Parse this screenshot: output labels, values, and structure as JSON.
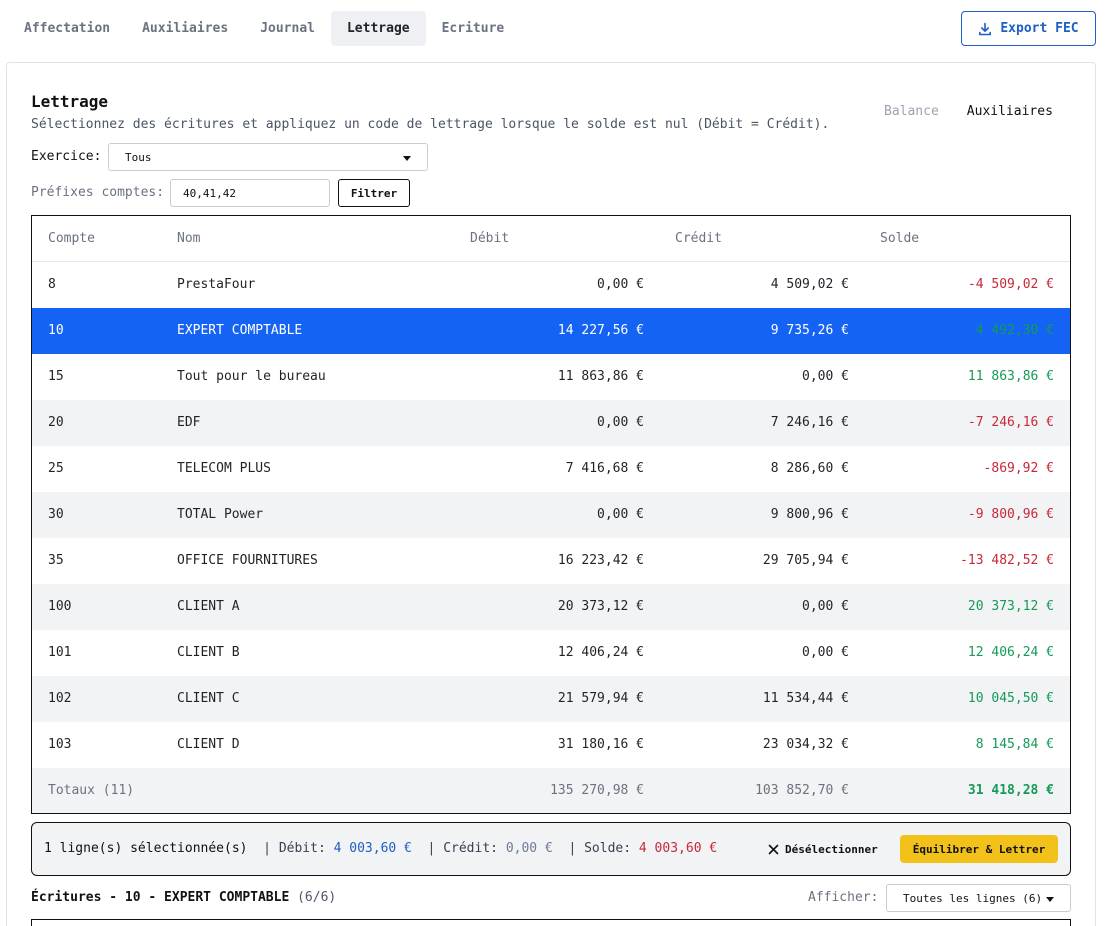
{
  "tabs": [
    "Affectation",
    "Auxiliaires",
    "Journal",
    "Lettrage",
    "Ecriture"
  ],
  "active_tab": "Lettrage",
  "export_label": "Export FEC",
  "title": "Lettrage",
  "subtitle": "Sélectionnez des écritures et appliquez un code de lettrage lorsque le solde est nul (Débit = Crédit).",
  "view_switch": [
    "Balance",
    "Auxiliaires"
  ],
  "exercice": {
    "label": "Exercice:",
    "value": "Tous"
  },
  "prefixes": {
    "label": "Préfixes comptes:",
    "value": "40,41,42",
    "button": "Filtrer"
  },
  "table": {
    "headers": [
      "Compte",
      "Nom",
      "Débit",
      "Crédit",
      "Solde"
    ],
    "rows": [
      {
        "compte": "8",
        "nom": "PrestaFour",
        "debit": "0,00 €",
        "credit": "4 509,02 €",
        "solde": "-4 509,02 €",
        "sign": "neg"
      },
      {
        "compte": "10",
        "nom": "EXPERT COMPTABLE",
        "debit": "14 227,56 €",
        "credit": "9 735,26 €",
        "solde": "4 492,30 €",
        "sign": "pos"
      },
      {
        "compte": "15",
        "nom": "Tout pour le bureau",
        "debit": "11 863,86 €",
        "credit": "0,00 €",
        "solde": "11 863,86 €",
        "sign": "pos"
      },
      {
        "compte": "20",
        "nom": "EDF",
        "debit": "0,00 €",
        "credit": "7 246,16 €",
        "solde": "-7 246,16 €",
        "sign": "neg"
      },
      {
        "compte": "25",
        "nom": "TELECOM PLUS",
        "debit": "7 416,68 €",
        "credit": "8 286,60 €",
        "solde": "-869,92 €",
        "sign": "neg"
      },
      {
        "compte": "30",
        "nom": "TOTAL Power",
        "debit": "0,00 €",
        "credit": "9 800,96 €",
        "solde": "-9 800,96 €",
        "sign": "neg"
      },
      {
        "compte": "35",
        "nom": "OFFICE FOURNITURES",
        "debit": "16 223,42 €",
        "credit": "29 705,94 €",
        "solde": "-13 482,52 €",
        "sign": "neg"
      },
      {
        "compte": "100",
        "nom": "CLIENT A",
        "debit": "20 373,12 €",
        "credit": "0,00 €",
        "solde": "20 373,12 €",
        "sign": "pos"
      },
      {
        "compte": "101",
        "nom": "CLIENT B",
        "debit": "12 406,24 €",
        "credit": "0,00 €",
        "solde": "12 406,24 €",
        "sign": "pos"
      },
      {
        "compte": "102",
        "nom": "CLIENT C",
        "debit": "21 579,94 €",
        "credit": "11 534,44 €",
        "solde": "10 045,50 €",
        "sign": "pos"
      },
      {
        "compte": "103",
        "nom": "CLIENT D",
        "debit": "31 180,16 €",
        "credit": "23 034,32 €",
        "solde": "8 145,84 €",
        "sign": "pos"
      }
    ],
    "selected_row": "10",
    "totals": {
      "label": "Totaux (11)",
      "debit": "135 270,98 €",
      "credit": "103 852,70 €",
      "solde": "31 418,28 €"
    }
  },
  "selection": {
    "count": "1 ligne(s) sélectionnée(s)",
    "debit_label": "Débit:",
    "debit": "4 003,60 €",
    "credit_label": "Crédit:",
    "credit": "0,00 €",
    "solde_label": "Solde:",
    "solde": "4 003,60 €",
    "deselect": "Désélectionner",
    "apply": "Équilibrer & Lettrer"
  },
  "ecritures": {
    "title": "Écritures - 10 - EXPERT COMPTABLE",
    "count": "(6/6)",
    "afficher_label": "Afficher:",
    "afficher_value": "Toutes les lignes (6)"
  },
  "colors": {
    "accent": "#1d5fc5",
    "selected": "#1563f4",
    "positive": "#159a57",
    "negative": "#c8283b",
    "apply_button": "#f2c21b"
  }
}
